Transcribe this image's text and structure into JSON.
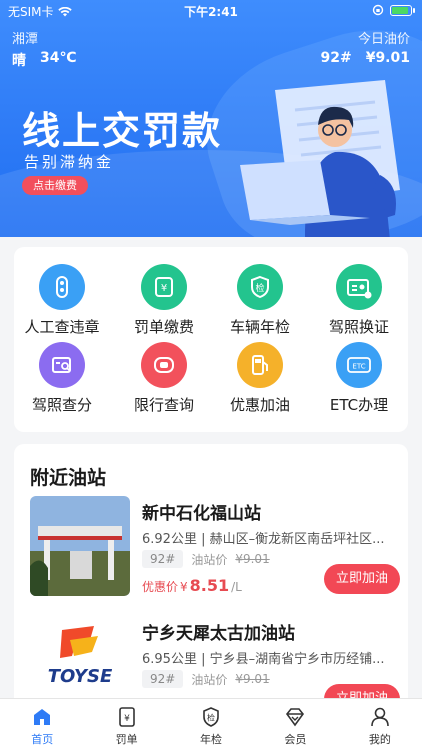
{
  "status_bar": {
    "carrier": "无SIM卡",
    "time": "下午2:41"
  },
  "header": {
    "city": "湘潭",
    "weather": "晴",
    "temperature": "34℃",
    "oil_label": "今日油价",
    "oil_grade": "92#",
    "oil_price": "¥9.01"
  },
  "banner": {
    "title": "线上交罚款",
    "subtitle": "告别滞纳金",
    "button": "点击缴费"
  },
  "services": [
    {
      "label": "人工查违章",
      "icon": "traffic-light-icon",
      "color": "#3aa0f5"
    },
    {
      "label": "罚单缴费",
      "icon": "fine-ticket-icon",
      "color": "#23c48e"
    },
    {
      "label": "车辆年检",
      "icon": "inspection-shield-icon",
      "color": "#23c48e"
    },
    {
      "label": "驾照换证",
      "icon": "license-card-icon",
      "color": "#23c48e"
    },
    {
      "label": "驾照查分",
      "icon": "license-search-icon",
      "color": "#8b6cf0"
    },
    {
      "label": "限行查询",
      "icon": "restriction-icon",
      "color": "#f2515c"
    },
    {
      "label": "优惠加油",
      "icon": "fuel-pump-icon",
      "color": "#f5b12a"
    },
    {
      "label": "ETC办理",
      "icon": "etc-icon",
      "color": "#3aa0f5"
    }
  ],
  "nearby": {
    "title": "附近油站",
    "stations": [
      {
        "name": "新中石化福山站",
        "address": "6.92公里 | 赫山区–衡龙新区南岳坪社区...",
        "grade": "92#",
        "station_price_label": "油站价",
        "station_price": "¥9.01",
        "discount_label": "优惠价",
        "discount_currency": "¥",
        "discount_price": "8.51",
        "discount_unit": "/L",
        "button": "立即加油"
      },
      {
        "name": "宁乡天犀太古加油站",
        "address": "6.95公里 | 宁乡县–湖南省宁乡市历经铺...",
        "grade": "92#",
        "station_price_label": "油站价",
        "station_price": "¥9.01",
        "button": "立即加油",
        "logo_text": "TOYSE"
      }
    ]
  },
  "tabbar": [
    {
      "label": "首页",
      "icon": "home-icon",
      "active": true
    },
    {
      "label": "罚单",
      "icon": "ticket-icon",
      "active": false
    },
    {
      "label": "年检",
      "icon": "inspection-icon",
      "active": false
    },
    {
      "label": "会员",
      "icon": "member-diamond-icon",
      "active": false
    },
    {
      "label": "我的",
      "icon": "profile-icon",
      "active": false
    }
  ]
}
